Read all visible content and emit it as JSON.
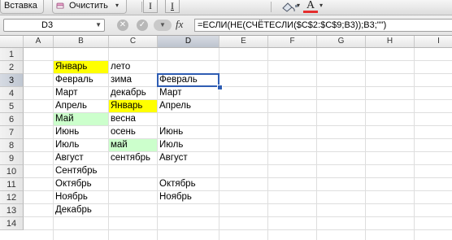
{
  "toolbar": {
    "paste_label": "Вставка",
    "clear_label": "Очистить",
    "italic_glyph": "I",
    "underline_glyph": "I",
    "font_color_glyph": "A"
  },
  "formula_bar": {
    "name_box": "D3",
    "fx_label": "fx",
    "formula": "=ЕСЛИ(НЕ(СЧЁТЕСЛИ($C$2:$C$9;B3));B3;\"\")"
  },
  "columns": [
    "A",
    "B",
    "C",
    "D",
    "E",
    "F",
    "G",
    "H",
    "I"
  ],
  "active_column": "D",
  "rows": [
    {
      "num": "1",
      "B": "",
      "C": "",
      "D": ""
    },
    {
      "num": "2",
      "B": "Январь",
      "C": "лето",
      "D": ""
    },
    {
      "num": "3",
      "B": "Февраль",
      "C": "зима",
      "D": "Февраль"
    },
    {
      "num": "4",
      "B": "Март",
      "C": "декабрь",
      "D": "Март"
    },
    {
      "num": "5",
      "B": "Апрель",
      "C": "Январь",
      "D": "Апрель"
    },
    {
      "num": "6",
      "B": "Май",
      "C": "весна",
      "D": ""
    },
    {
      "num": "7",
      "B": "Июнь",
      "C": "осень",
      "D": "Июнь"
    },
    {
      "num": "8",
      "B": "Июль",
      "C": "май",
      "D": "Июль"
    },
    {
      "num": "9",
      "B": "Август",
      "C": "сентябрь",
      "D": "Август"
    },
    {
      "num": "10",
      "B": "Сентябрь",
      "C": "",
      "D": ""
    },
    {
      "num": "11",
      "B": "Октябрь",
      "C": "",
      "D": "Октябрь"
    },
    {
      "num": "12",
      "B": "Ноябрь",
      "C": "",
      "D": "Ноябрь"
    },
    {
      "num": "13",
      "B": "Декабрь",
      "C": "",
      "D": ""
    },
    {
      "num": "14",
      "B": "",
      "C": "",
      "D": ""
    }
  ],
  "active_row": "3",
  "highlights": [
    {
      "cell": "B2",
      "color": "#ffff00"
    },
    {
      "cell": "C5",
      "color": "#ffff00"
    },
    {
      "cell": "B6",
      "color": "#ccffcc"
    },
    {
      "cell": "C8",
      "color": "#ccffcc"
    }
  ],
  "selected_cell": "D3",
  "colors": {
    "selection": "#2f5db3",
    "highlight_yellow": "#ffff00",
    "highlight_green": "#ccffcc"
  }
}
